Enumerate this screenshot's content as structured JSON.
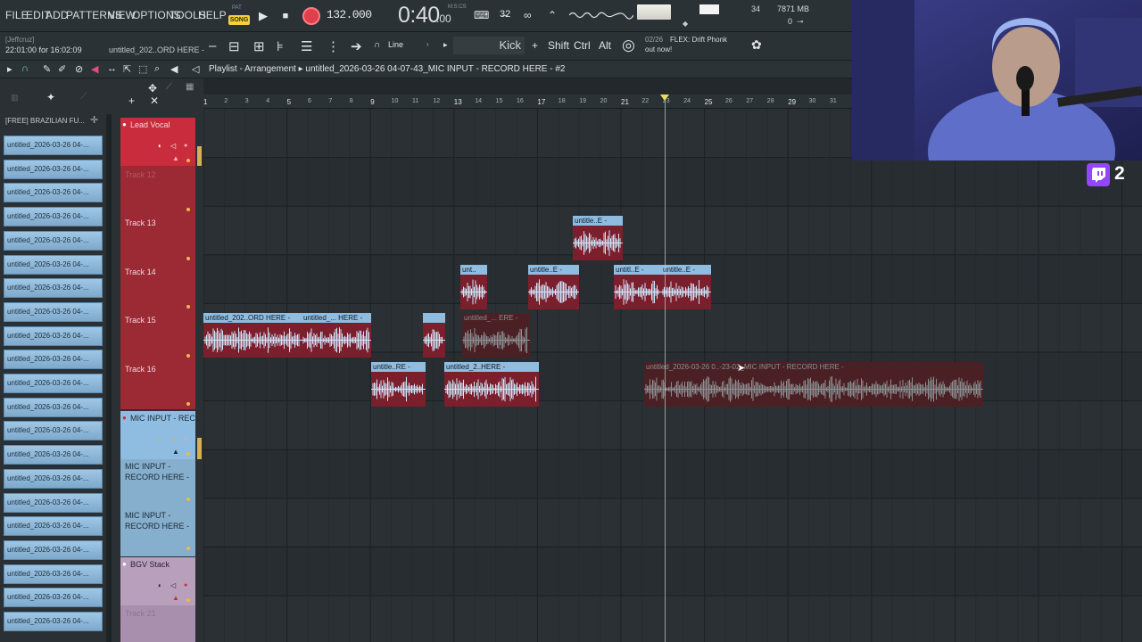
{
  "menu": [
    "FILE",
    "EDIT",
    "ADD",
    "PATTERNS",
    "VIEW",
    "OPTIONS",
    "TOOLS",
    "HELP"
  ],
  "transport": {
    "pat_label": "PAT",
    "song_label": "SONG",
    "tempo": "132.000",
    "time": "0:40",
    "time_sub": ":00",
    "time_unit": "M:S:CS",
    "cpu": "34",
    "memory": "7871 MB",
    "polyphony": "0"
  },
  "toolbar2": {
    "user": "[Jeffcruz]",
    "clock": "22:01:00 for 16:02:09",
    "project": "untitled_202..ORD HERE -",
    "snap": "Line",
    "instrument": "Kick",
    "modifiers": [
      "Shift",
      "Ctrl",
      "Alt"
    ],
    "hint_count": "02/26",
    "hint_text": "FLEX: Drift Phonk",
    "hint_text2": "out now!"
  },
  "playlist": {
    "title": "Playlist - Arrangement",
    "arrangement": "untitled_2026-03-26 04-07-43_MIC INPUT - RECORD HERE - #2",
    "ruler": [
      "1",
      "2",
      "3",
      "4",
      "5",
      "6",
      "7",
      "8",
      "9",
      "10",
      "11",
      "12",
      "13",
      "14",
      "15",
      "16",
      "17",
      "18",
      "19",
      "20",
      "21",
      "22",
      "23",
      "24",
      "25",
      "26",
      "27",
      "28",
      "29",
      "30",
      "31"
    ]
  },
  "browser": {
    "title": "[FREE] BRAZILIAN FU...",
    "items": [
      "untitled_2026-03-26 04-...",
      "untitled_2026-03-26 04-...",
      "untitled_2026-03-26 04-...",
      "untitled_2026-03-26 04-...",
      "untitled_2026-03-26 04-...",
      "untitled_2026-03-26 04-...",
      "untitled_2026-03-26 04-...",
      "untitled_2026-03-26 04-...",
      "untitled_2026-03-26 04-...",
      "untitled_2026-03-26 04-...",
      "untitled_2026-03-26 04-...",
      "untitled_2026-03-26 04-...",
      "untitled_2026-03-26 04-...",
      "untitled_2026-03-26 04-...",
      "untitled_2026-03-26 04-...",
      "untitled_2026-03-26 04-...",
      "untitled_2026-03-26 04-...",
      "untitled_2026-03-26 04-...",
      "untitled_2026-03-26 04-...",
      "untitled_2026-03-26 04-...",
      "untitled_2026-03-26 04-..."
    ]
  },
  "tracks": {
    "lead_vocal": "Lead Vocal",
    "t12": "Track 12",
    "t13": "Track 13",
    "t14": "Track 14",
    "t15": "Track 15",
    "t16": "Track 16",
    "mic_group": "MIC INPUT - REC...",
    "mic1_line1": "MIC INPUT -",
    "mic1_line2": "RECORD HERE -",
    "mic2_line1": "MIC INPUT -",
    "mic2_line2": "RECORD HERE -",
    "bgv": "BGV Stack",
    "t21": "Track 21"
  },
  "clips": {
    "c13a": "untitle..E -",
    "c14a": "unt..",
    "c14b": "untitle..E -",
    "c14c": "untitl..E -",
    "c14d": "untitle..E -",
    "c15a": "untitled_202..ORD HERE -",
    "c15b": "untitled_... HERE -",
    "c15c": "",
    "c15d": "untitled_... ERE -",
    "c16a": "untitle..RE -",
    "c16b": "untitled_2..HERE -",
    "c16c": "untitled_2026-03-26 0..-23-02_MIC INPUT - RECORD HERE -"
  },
  "overlay": {
    "viewer_count": "2",
    "colors": {
      "twitch": "#9146ff",
      "track_red": "#9b2a35",
      "track_blue": "#8fbde2",
      "track_mauve": "#b8a0bd",
      "song_yellow": "#f3d23c"
    }
  }
}
